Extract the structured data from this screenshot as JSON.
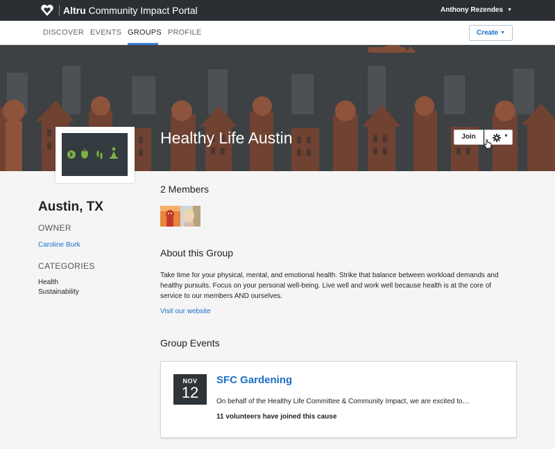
{
  "app": {
    "brand_bold": "Altru",
    "brand_rest": " Community Impact Portal",
    "user_name": "Anthony Rezendes"
  },
  "nav": {
    "items": [
      "DISCOVER",
      "EVENTS",
      "GROUPS",
      "PROFILE"
    ],
    "active": "GROUPS",
    "create_label": "Create"
  },
  "group": {
    "name": "Healthy Life Austin",
    "join_label": "Join",
    "location": "Austin, TX",
    "owner_heading": "OWNER",
    "owner_name": "Caroline Burk",
    "categories_heading": "CATEGORIES",
    "categories": [
      "Health",
      "Sustainability"
    ]
  },
  "members": {
    "heading": "2 Members"
  },
  "about": {
    "heading": "About this Group",
    "text": "Take time for your physical, mental, and emotional health. Strike that balance between workload demands and healthy pursuits. Focus on your personal well-being. Live well and work well because health is at the core of service to our members AND ourselves.",
    "website_link": "Visit our website"
  },
  "events": {
    "heading": "Group Events",
    "items": [
      {
        "month": "NOV",
        "day": "12",
        "title": "SFC Gardening",
        "description": "On behalf of the Healthy Life Committee & Community Impact, we are excited to…",
        "volunteers": "11 volunteers have joined this cause"
      }
    ]
  },
  "colors": {
    "topbar": "#2b2f34",
    "accent_blue": "#1a6fc7",
    "nav_underline": "#3b7bd4",
    "banner_rust": "#a35a3c",
    "logo_green": "#7cb342"
  },
  "icons": {
    "logo": "altru-heart-logo-icon",
    "gear": "gear-icon",
    "caret": "caret-down-icon",
    "cursor": "hand-cursor-icon"
  }
}
